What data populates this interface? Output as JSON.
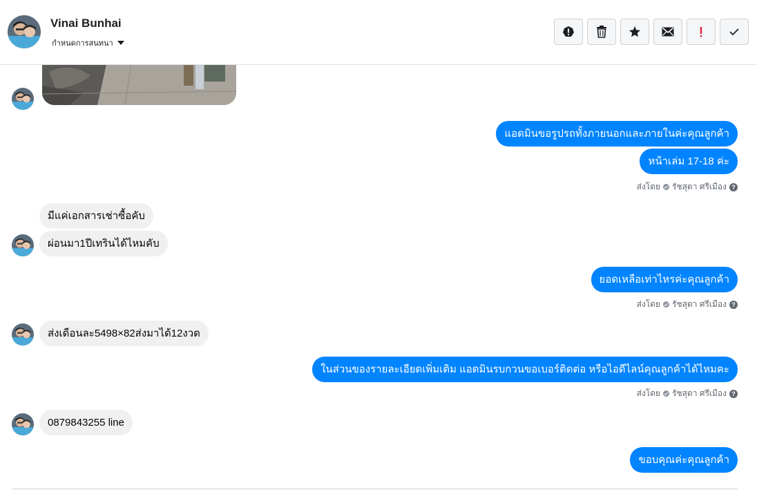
{
  "header": {
    "contact_name": "Vinai Bunhai",
    "assign_label": "กำหนดการสนทนา",
    "actions": {
      "report": "exclamation-circle-icon",
      "delete": "trash-icon",
      "star": "star-icon",
      "mark_unread": "envelope-icon",
      "important": "red-exclamation-icon",
      "done": "checkmark-icon"
    }
  },
  "messages": {
    "m1_out": "แอดมินขอรูปรถทั้งภายนอกและภายในค่ะคุณลูกค้า",
    "m2_out": "หน้าเล่ม 17-18 ค่ะ",
    "m3_in": "มีแค่เอกสารเช่าซื้อคับ",
    "m4_in": "ผ่อนมา1ปีเทรินได้ไหมคับ",
    "m5_out": "ยอดเหลือเท่าไหรค่ะคุณลูกค้า",
    "m6_in": "ส่งเดือนละ5498×82ส่งมาได้12งวด",
    "m7_out": "ในส่วนของรายละเอียดเพิ่มเติม แอดมินรบกวนขอเบอร์ติดต่อ หรือไอดีไลน์คุณลูกค้าได้ไหมคะ",
    "m8_in": "0879843255 line",
    "m9_out": "ขอบคุณค่ะคุณลูกค้า"
  },
  "sent_by": {
    "prefix": "ส่งโดย",
    "name": "รัชสุดา ศรีเมือง",
    "help": "?"
  },
  "colors": {
    "outgoing_bubble": "#0084ff",
    "incoming_bubble": "#f0f0f0",
    "important_icon": "#e41e3f"
  }
}
